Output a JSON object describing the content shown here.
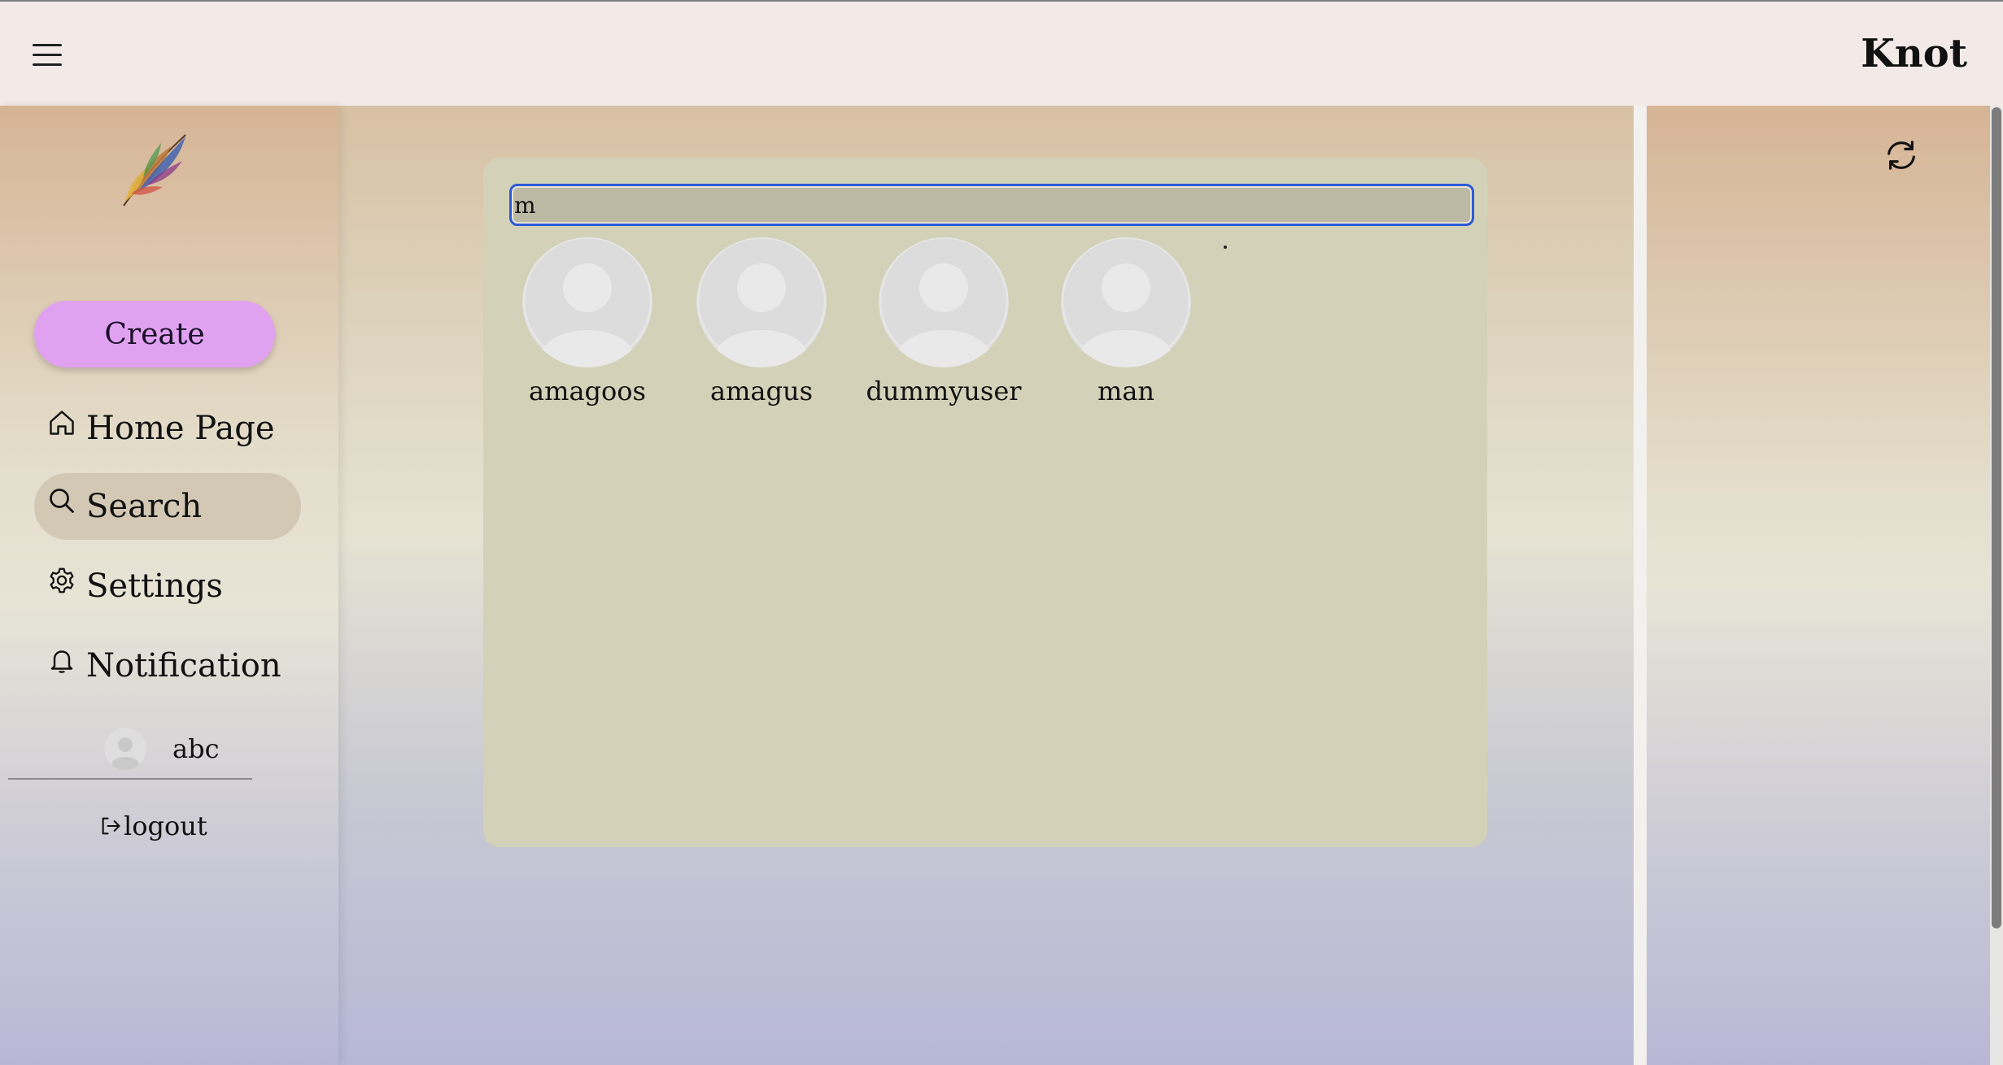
{
  "header": {
    "brand": "Knot",
    "menu_icon": "hamburger-menu-icon"
  },
  "sidebar": {
    "logo_icon": "feather-logo-icon",
    "create_label": "Create",
    "items": [
      {
        "label": "Home Page",
        "icon": "home-icon",
        "active": false
      },
      {
        "label": "Search",
        "icon": "search-icon",
        "active": true
      },
      {
        "label": "Settings",
        "icon": "gear-icon",
        "active": false
      },
      {
        "label": "Notification",
        "icon": "bell-icon",
        "active": false
      }
    ],
    "profile": {
      "name": "abc",
      "avatar_icon": "user-avatar-icon"
    },
    "logout_label": "logout"
  },
  "search": {
    "value": "m",
    "results": [
      {
        "name": "amagoos"
      },
      {
        "name": "amagus"
      },
      {
        "name": "dummyuser"
      },
      {
        "name": "man"
      }
    ]
  },
  "right_panel": {
    "refresh_icon": "refresh-icon"
  },
  "colors": {
    "create_button": "#e0a2f0",
    "active_nav": "#d2c8b4",
    "panel": "#d3d1b8",
    "input_focus": "#2d5bd8"
  }
}
